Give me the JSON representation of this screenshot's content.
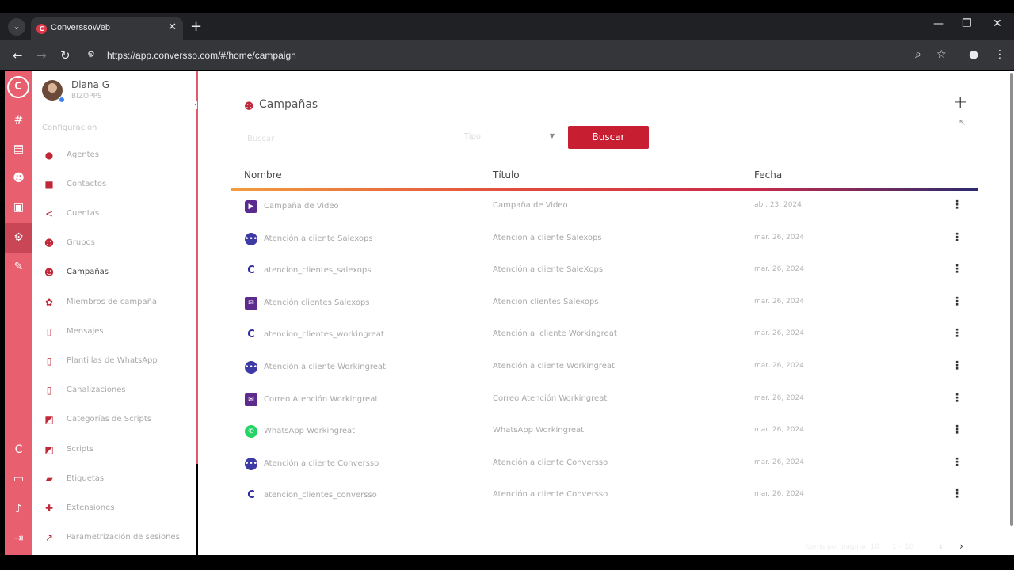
{
  "browser": {
    "tab_title": "ConverssoWeb",
    "url": "https://app.conversso.com/#/home/campaign"
  },
  "user": {
    "name": "Diana G",
    "role": "BIZOPPS"
  },
  "sidebar": {
    "section_title": "Configuración",
    "items": [
      {
        "label": "Agentes",
        "icon": "agent-icon"
      },
      {
        "label": "Contactos",
        "icon": "contacts-icon"
      },
      {
        "label": "Cuentas",
        "icon": "share-icon"
      },
      {
        "label": "Grupos",
        "icon": "group-icon"
      },
      {
        "label": "Campañas",
        "icon": "campaign-icon",
        "active": true
      },
      {
        "label": "Miembros de campaña",
        "icon": "members-icon"
      },
      {
        "label": "Mensajes",
        "icon": "bookmark-icon"
      },
      {
        "label": "Plantillas de WhatsApp",
        "icon": "bookmark-icon"
      },
      {
        "label": "Canalizaciones",
        "icon": "bookmark-icon"
      },
      {
        "label": "Categorías de Scripts",
        "icon": "script-icon"
      },
      {
        "label": "Scripts",
        "icon": "script-icon"
      },
      {
        "label": "Etiquetas",
        "icon": "label-icon"
      },
      {
        "label": "Extensiones",
        "icon": "puzzle-icon"
      },
      {
        "label": "Parametrización de sesiones",
        "icon": "trend-icon"
      }
    ]
  },
  "page": {
    "title": "Campañas",
    "search_placeholder": "Buscar",
    "type_label": "Tipo",
    "search_button": "Buscar"
  },
  "table": {
    "columns": [
      "Nombre",
      "Título",
      "Fecha"
    ],
    "rows": [
      {
        "name": "Campaña de Video",
        "title": "Campaña de Video",
        "date": "abr. 23, 2024",
        "icon": "video"
      },
      {
        "name": "Atención a cliente Salexops",
        "title": "Atención a cliente Salexops",
        "date": "mar. 26, 2024",
        "icon": "chat"
      },
      {
        "name": "atencion_clientes_salexops",
        "title": "Atención a cliente SaleXops",
        "date": "mar. 26, 2024",
        "icon": "conversso"
      },
      {
        "name": "Atención clientes Salexops",
        "title": "Atención clientes Salexops",
        "date": "mar. 26, 2024",
        "icon": "mail"
      },
      {
        "name": "atencion_clientes_workingreat",
        "title": "Atención al cliente Workingreat",
        "date": "mar. 26, 2024",
        "icon": "conversso"
      },
      {
        "name": "Atención a cliente Workingreat",
        "title": "Atención a cliente Workingreat",
        "date": "mar. 26, 2024",
        "icon": "chat"
      },
      {
        "name": "Correo Atención Workingreat",
        "title": "Correo Atención Workingreat",
        "date": "mar. 26, 2024",
        "icon": "mail"
      },
      {
        "name": "WhatsApp Workingreat",
        "title": "WhatsApp Workingreat",
        "date": "mar. 26, 2024",
        "icon": "whatsapp"
      },
      {
        "name": "Atención a cliente Conversso",
        "title": "Atención a cliente Conversso",
        "date": "mar. 26, 2024",
        "icon": "chat"
      },
      {
        "name": "atencion_clientes_conversso",
        "title": "Atención a cliente Conversso",
        "date": "mar. 26, 2024",
        "icon": "conversso"
      }
    ]
  },
  "pagination": {
    "items_per_page_label": "Items por página: 10",
    "range": "1 – 10"
  },
  "colors": {
    "brand": "#c81e32",
    "rail": "#e8606f"
  }
}
